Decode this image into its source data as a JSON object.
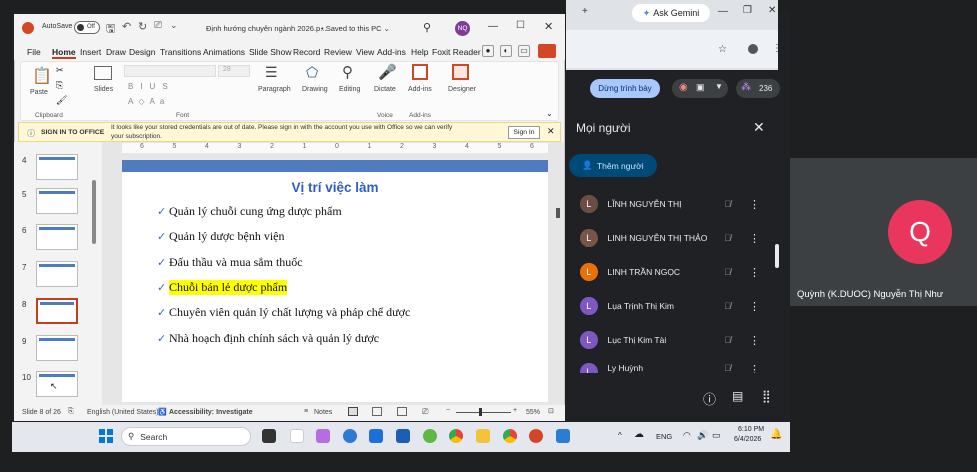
{
  "browser": {
    "gemini_label": "Ask Gemini"
  },
  "meet": {
    "present_label": "Dừng trình bày",
    "participant_count": "236",
    "people_title": "Mọi người",
    "add_people_label": "Thêm người",
    "participants": [
      {
        "initial": "L",
        "name": "LĨNH NGUYỄN THỊ",
        "color": "#6d4c41"
      },
      {
        "initial": "L",
        "name": "LINH NGUYỄN THỊ THẢO",
        "color": "#795548"
      },
      {
        "initial": "L",
        "name": "LINH TRẦN NGỌC",
        "color": "#e8710a"
      },
      {
        "initial": "L",
        "name": "Lụa Trịnh Thị Kim",
        "color": "#7e57c2"
      },
      {
        "initial": "L",
        "name": "Lục Thị Kim Tài",
        "color": "#7e57c2"
      },
      {
        "initial": "L",
        "name": "Ly Huỳnh",
        "color": "#7e57c2"
      }
    ],
    "tile_initial": "Q",
    "tile_name": "Quỳnh (K.DUOC) Nguyễn Thị Như"
  },
  "ppt": {
    "autosave_label": "AutoSave",
    "autosave_state": "Off",
    "doc_title": "Định hướng chuyên ngành 2026.p...",
    "saved_label": "Saved to this PC",
    "user_initials": "NQ",
    "menu": [
      "File",
      "Home",
      "Insert",
      "Draw",
      "Design",
      "Transitions",
      "Animations",
      "Slide Show",
      "Record",
      "Review",
      "View",
      "Add-ins",
      "Help",
      "Foxit Reader"
    ],
    "ribbon": {
      "paste": "Paste",
      "clipboard": "Clipboard",
      "slides": "Slides",
      "font_size": "28",
      "font_group": "Font",
      "paragraph": "Paragraph",
      "drawing": "Drawing",
      "editing": "Editing",
      "dictate": "Dictate",
      "voice_group": "Voice",
      "addins": "Add-ins",
      "addins_group": "Add-ins",
      "designer": "Designer"
    },
    "infobar": {
      "title": "SIGN IN TO OFFICE",
      "message_line1": "It looks like your stored credentials are out of date. Please sign in with the account you use with Office so we can verify",
      "message_line2": "your subscription.",
      "signin_label": "Sign In"
    },
    "thumb_numbers": [
      "4",
      "5",
      "6",
      "7",
      "8",
      "9",
      "10"
    ],
    "ruler_marks": [
      "6",
      "5",
      "4",
      "3",
      "2",
      "1",
      "0",
      "1",
      "2",
      "3",
      "4",
      "5",
      "6"
    ],
    "slide": {
      "title": "Vị trí việc làm",
      "bullets": [
        "Quản lý chuỗi cung ứng dược phẩm",
        "Quản lý dược bệnh viện",
        "Đấu thầu và mua sắm thuốc",
        "Chuỗi bán lẻ dược phẩm",
        "Chuyên viên quản lý chất lượng và pháp chế dược",
        "Nhà hoạch định chính sách và quản lý dược"
      ],
      "highlighted_index": 3
    },
    "status": {
      "slide_of": "Slide 8 of 26",
      "language": "English (United States)",
      "accessibility": "Accessibility: Investigate",
      "notes": "Notes",
      "zoom": "55%"
    }
  },
  "taskbar": {
    "search_label": "Search",
    "language": "ENG",
    "time": "6:10 PM",
    "date": "6/4/2026"
  }
}
